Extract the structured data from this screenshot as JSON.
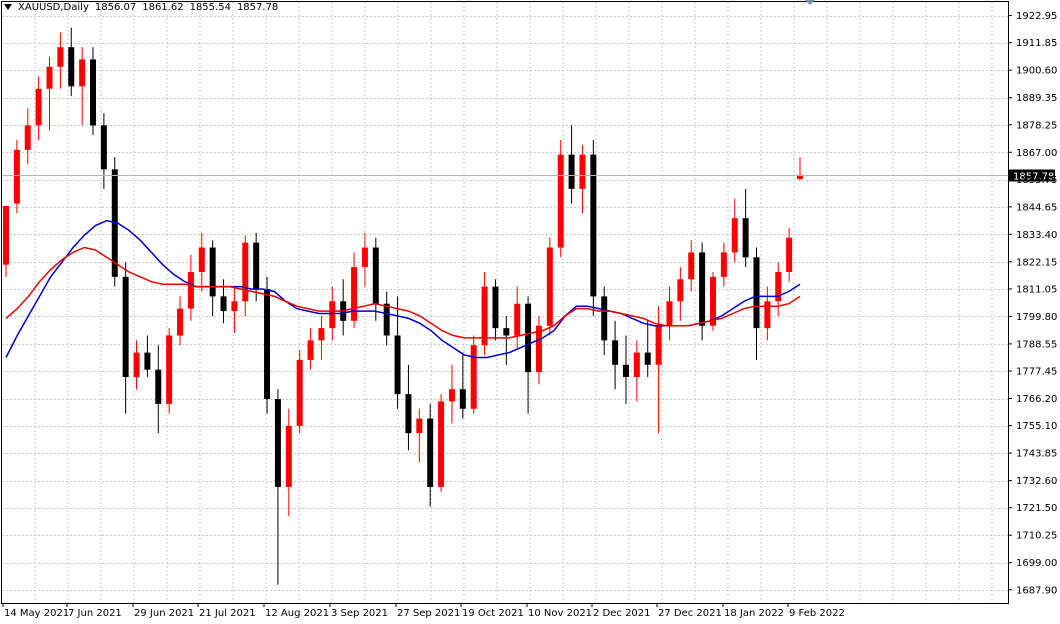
{
  "header": {
    "symbol": "XAUUSD,Daily",
    "open": "1856.07",
    "high": "1861.62",
    "low": "1855.54",
    "close": "1857.78"
  },
  "chart_data": {
    "type": "candlestick",
    "symbol": "XAUUSD",
    "timeframe": "Daily",
    "ylim": [
      1682.5,
      1928.5
    ],
    "y_ticks": [
      "1922.95",
      "1911.85",
      "1900.60",
      "1889.35",
      "1878.25",
      "1867.00",
      "1855.75",
      "1844.65",
      "1833.40",
      "1822.15",
      "1811.05",
      "1799.80",
      "1788.55",
      "1777.45",
      "1766.20",
      "1755.10",
      "1743.85",
      "1732.60",
      "1721.50",
      "1710.25",
      "1699.00",
      "1687.90"
    ],
    "x_ticks": [
      "14 May 2021",
      "7 Jun 2021",
      "29 Jun 2021",
      "21 Jul 2021",
      "12 Aug 2021",
      "3 Sep 2021",
      "27 Sep 2021",
      "19 Oct 2021",
      "10 Nov 2021",
      "2 Dec 2021",
      "27 Dec 2021",
      "18 Jan 2022",
      "9 Feb 2022"
    ],
    "current_price": "1857.78",
    "colors": {
      "bull": "#ff0000",
      "bear": "#000000",
      "ma_fast": "#0000cc",
      "ma_slow": "#ee0000",
      "grid": "#c8c8c8",
      "price_line": "#b4b4b4",
      "price_label_bg": "#000000"
    },
    "grid": true,
    "series": [
      {
        "name": "",
        "kind": "ma_fast",
        "values": [
          1783,
          1792,
          1800,
          1808,
          1816,
          1822,
          1828,
          1833,
          1837,
          1839,
          1838,
          1835,
          1831,
          1826,
          1821,
          1817,
          1814,
          1812,
          1812,
          1812,
          1812,
          1812,
          1811,
          1811,
          1810,
          1806,
          1803,
          1802,
          1801,
          1801,
          1801,
          1802,
          1802,
          1802,
          1801,
          1800,
          1799,
          1797,
          1794,
          1790,
          1787,
          1784,
          1783,
          1783,
          1784,
          1785,
          1787,
          1789,
          1791,
          1794,
          1800,
          1804,
          1804,
          1803,
          1802,
          1801,
          1799,
          1797,
          1796,
          1796,
          1796,
          1796,
          1797,
          1798,
          1800,
          1803,
          1806,
          1808,
          1808,
          1808,
          1810,
          1813
        ]
      },
      {
        "name": "",
        "kind": "ma_slow",
        "values": [
          1799,
          1803,
          1808,
          1814,
          1819,
          1823,
          1826,
          1828,
          1827,
          1824,
          1821,
          1818,
          1816,
          1814,
          1813,
          1813,
          1813,
          1812,
          1812,
          1812,
          1812,
          1811,
          1810,
          1809,
          1808,
          1806,
          1804,
          1803,
          1802,
          1802,
          1802,
          1803,
          1804,
          1805,
          1804,
          1803,
          1802,
          1800,
          1797,
          1794,
          1792,
          1791,
          1791,
          1791,
          1791,
          1791,
          1792,
          1793,
          1794,
          1796,
          1800,
          1803,
          1803,
          1802,
          1802,
          1801,
          1800,
          1799,
          1797,
          1796,
          1796,
          1796,
          1797,
          1798,
          1799,
          1801,
          1803,
          1804,
          1804,
          1804,
          1805,
          1808
        ]
      }
    ],
    "candles": [
      {
        "o": 1821,
        "h": 1836,
        "l": 1816,
        "c": 1845
      },
      {
        "o": 1846,
        "h": 1872,
        "l": 1842,
        "c": 1868
      },
      {
        "o": 1868,
        "h": 1885,
        "l": 1862,
        "c": 1878
      },
      {
        "o": 1878,
        "h": 1898,
        "l": 1872,
        "c": 1893
      },
      {
        "o": 1893,
        "h": 1906,
        "l": 1876,
        "c": 1902
      },
      {
        "o": 1902,
        "h": 1916,
        "l": 1893,
        "c": 1910
      },
      {
        "o": 1910,
        "h": 1918,
        "l": 1890,
        "c": 1894
      },
      {
        "o": 1894,
        "h": 1910,
        "l": 1878,
        "c": 1905
      },
      {
        "o": 1905,
        "h": 1910,
        "l": 1874,
        "c": 1878
      },
      {
        "o": 1878,
        "h": 1883,
        "l": 1852,
        "c": 1860
      },
      {
        "o": 1860,
        "h": 1865,
        "l": 1812,
        "c": 1816
      },
      {
        "o": 1816,
        "h": 1822,
        "l": 1760,
        "c": 1775
      },
      {
        "o": 1775,
        "h": 1790,
        "l": 1770,
        "c": 1785
      },
      {
        "o": 1785,
        "h": 1792,
        "l": 1775,
        "c": 1778
      },
      {
        "o": 1778,
        "h": 1788,
        "l": 1752,
        "c": 1764
      },
      {
        "o": 1764,
        "h": 1795,
        "l": 1760,
        "c": 1792
      },
      {
        "o": 1792,
        "h": 1808,
        "l": 1788,
        "c": 1803
      },
      {
        "o": 1803,
        "h": 1825,
        "l": 1798,
        "c": 1818
      },
      {
        "o": 1818,
        "h": 1834,
        "l": 1810,
        "c": 1828
      },
      {
        "o": 1828,
        "h": 1831,
        "l": 1800,
        "c": 1808
      },
      {
        "o": 1808,
        "h": 1815,
        "l": 1797,
        "c": 1802
      },
      {
        "o": 1802,
        "h": 1812,
        "l": 1793,
        "c": 1806
      },
      {
        "o": 1806,
        "h": 1833,
        "l": 1800,
        "c": 1830
      },
      {
        "o": 1830,
        "h": 1834,
        "l": 1806,
        "c": 1811
      },
      {
        "o": 1811,
        "h": 1816,
        "l": 1760,
        "c": 1766
      },
      {
        "o": 1766,
        "h": 1770,
        "l": 1690,
        "c": 1730
      },
      {
        "o": 1730,
        "h": 1762,
        "l": 1718,
        "c": 1755
      },
      {
        "o": 1755,
        "h": 1786,
        "l": 1752,
        "c": 1782
      },
      {
        "o": 1782,
        "h": 1795,
        "l": 1778,
        "c": 1790
      },
      {
        "o": 1790,
        "h": 1800,
        "l": 1782,
        "c": 1795
      },
      {
        "o": 1795,
        "h": 1812,
        "l": 1790,
        "c": 1806
      },
      {
        "o": 1806,
        "h": 1815,
        "l": 1792,
        "c": 1798
      },
      {
        "o": 1798,
        "h": 1826,
        "l": 1795,
        "c": 1820
      },
      {
        "o": 1820,
        "h": 1834,
        "l": 1812,
        "c": 1828
      },
      {
        "o": 1828,
        "h": 1832,
        "l": 1798,
        "c": 1805
      },
      {
        "o": 1805,
        "h": 1810,
        "l": 1788,
        "c": 1792
      },
      {
        "o": 1792,
        "h": 1808,
        "l": 1762,
        "c": 1768
      },
      {
        "o": 1768,
        "h": 1780,
        "l": 1745,
        "c": 1752
      },
      {
        "o": 1752,
        "h": 1762,
        "l": 1740,
        "c": 1758
      },
      {
        "o": 1758,
        "h": 1764,
        "l": 1722,
        "c": 1730
      },
      {
        "o": 1730,
        "h": 1768,
        "l": 1728,
        "c": 1765
      },
      {
        "o": 1765,
        "h": 1780,
        "l": 1756,
        "c": 1770
      },
      {
        "o": 1770,
        "h": 1785,
        "l": 1758,
        "c": 1762
      },
      {
        "o": 1762,
        "h": 1792,
        "l": 1760,
        "c": 1788
      },
      {
        "o": 1788,
        "h": 1818,
        "l": 1784,
        "c": 1812
      },
      {
        "o": 1812,
        "h": 1815,
        "l": 1790,
        "c": 1795
      },
      {
        "o": 1795,
        "h": 1800,
        "l": 1780,
        "c": 1792
      },
      {
        "o": 1792,
        "h": 1812,
        "l": 1786,
        "c": 1805
      },
      {
        "o": 1805,
        "h": 1808,
        "l": 1760,
        "c": 1777
      },
      {
        "o": 1777,
        "h": 1800,
        "l": 1772,
        "c": 1796
      },
      {
        "o": 1796,
        "h": 1832,
        "l": 1792,
        "c": 1828
      },
      {
        "o": 1828,
        "h": 1872,
        "l": 1824,
        "c": 1866
      },
      {
        "o": 1866,
        "h": 1878,
        "l": 1846,
        "c": 1852
      },
      {
        "o": 1852,
        "h": 1870,
        "l": 1842,
        "c": 1866
      },
      {
        "o": 1866,
        "h": 1872,
        "l": 1800,
        "c": 1808
      },
      {
        "o": 1808,
        "h": 1812,
        "l": 1784,
        "c": 1790
      },
      {
        "o": 1790,
        "h": 1798,
        "l": 1770,
        "c": 1780
      },
      {
        "o": 1780,
        "h": 1792,
        "l": 1764,
        "c": 1775
      },
      {
        "o": 1775,
        "h": 1790,
        "l": 1765,
        "c": 1785
      },
      {
        "o": 1785,
        "h": 1798,
        "l": 1775,
        "c": 1780
      },
      {
        "o": 1780,
        "h": 1804,
        "l": 1752,
        "c": 1796
      },
      {
        "o": 1796,
        "h": 1812,
        "l": 1790,
        "c": 1806
      },
      {
        "o": 1806,
        "h": 1820,
        "l": 1798,
        "c": 1815
      },
      {
        "o": 1815,
        "h": 1831,
        "l": 1810,
        "c": 1826
      },
      {
        "o": 1826,
        "h": 1830,
        "l": 1790,
        "c": 1796
      },
      {
        "o": 1796,
        "h": 1818,
        "l": 1794,
        "c": 1816
      },
      {
        "o": 1816,
        "h": 1830,
        "l": 1812,
        "c": 1826
      },
      {
        "o": 1826,
        "h": 1848,
        "l": 1822,
        "c": 1840
      },
      {
        "o": 1840,
        "h": 1852,
        "l": 1820,
        "c": 1824
      },
      {
        "o": 1824,
        "h": 1828,
        "l": 1782,
        "c": 1795
      },
      {
        "o": 1795,
        "h": 1812,
        "l": 1790,
        "c": 1806
      },
      {
        "o": 1806,
        "h": 1822,
        "l": 1800,
        "c": 1818
      },
      {
        "o": 1818,
        "h": 1836,
        "l": 1814,
        "c": 1832
      },
      {
        "o": 1856.07,
        "h": 1865,
        "l": 1855.54,
        "c": 1857.78
      }
    ]
  }
}
